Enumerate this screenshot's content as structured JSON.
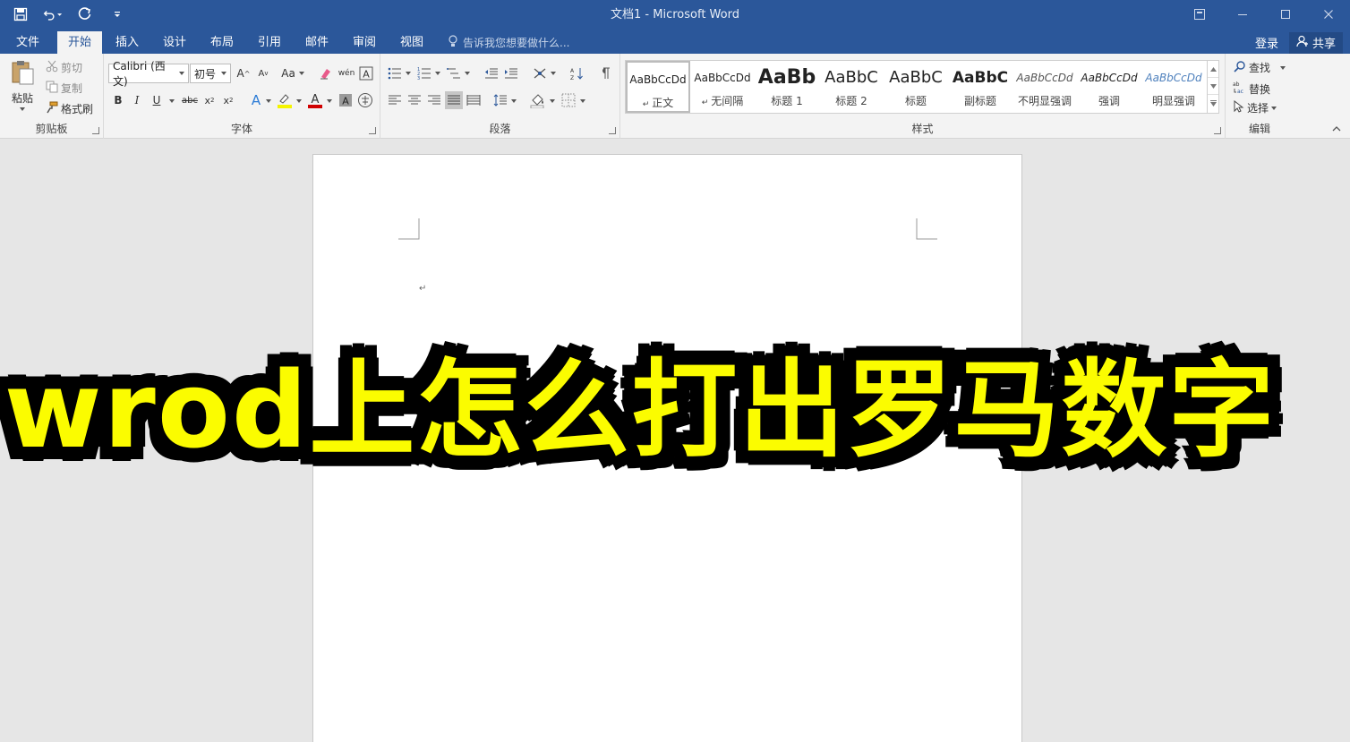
{
  "window": {
    "title": "文档1 - Microsoft Word"
  },
  "tabs": [
    {
      "label": "文件"
    },
    {
      "label": "开始"
    },
    {
      "label": "插入"
    },
    {
      "label": "设计"
    },
    {
      "label": "布局"
    },
    {
      "label": "引用"
    },
    {
      "label": "邮件"
    },
    {
      "label": "审阅"
    },
    {
      "label": "视图"
    }
  ],
  "tell_me": "告诉我您想要做什么...",
  "account": {
    "signin": "登录",
    "share": "共享"
  },
  "clipboard": {
    "paste": "粘贴",
    "cut": "剪切",
    "copy": "复制",
    "format_painter": "格式刷",
    "group_label": "剪贴板"
  },
  "font": {
    "family": "Calibri (西文)",
    "size": "初号",
    "case_label": "Aa",
    "group_label": "字体"
  },
  "paragraph": {
    "group_label": "段落"
  },
  "styles": {
    "group_label": "样式",
    "items": [
      {
        "preview": "AaBbCcDd",
        "name": "正文"
      },
      {
        "preview": "AaBbCcDd",
        "name": "无间隔"
      },
      {
        "preview": "AaBb",
        "name": "标题 1"
      },
      {
        "preview": "AaBbC",
        "name": "标题 2"
      },
      {
        "preview": "AaBbC",
        "name": "标题"
      },
      {
        "preview": "AaBbC",
        "name": "副标题"
      },
      {
        "preview": "AaBbCcDd",
        "name": "不明显强调"
      },
      {
        "preview": "AaBbCcDd",
        "name": "强调"
      },
      {
        "preview": "AaBbCcDd",
        "name": "明显强调"
      }
    ]
  },
  "editing": {
    "find": "查找",
    "replace": "替换",
    "select": "选择",
    "group_label": "编辑"
  },
  "overlay": {
    "text": "wrod上怎么打出罗马数字"
  },
  "colors": {
    "brand": "#2b579a",
    "overlay_fill": "#fbfc00",
    "overlay_stroke": "#000000"
  }
}
